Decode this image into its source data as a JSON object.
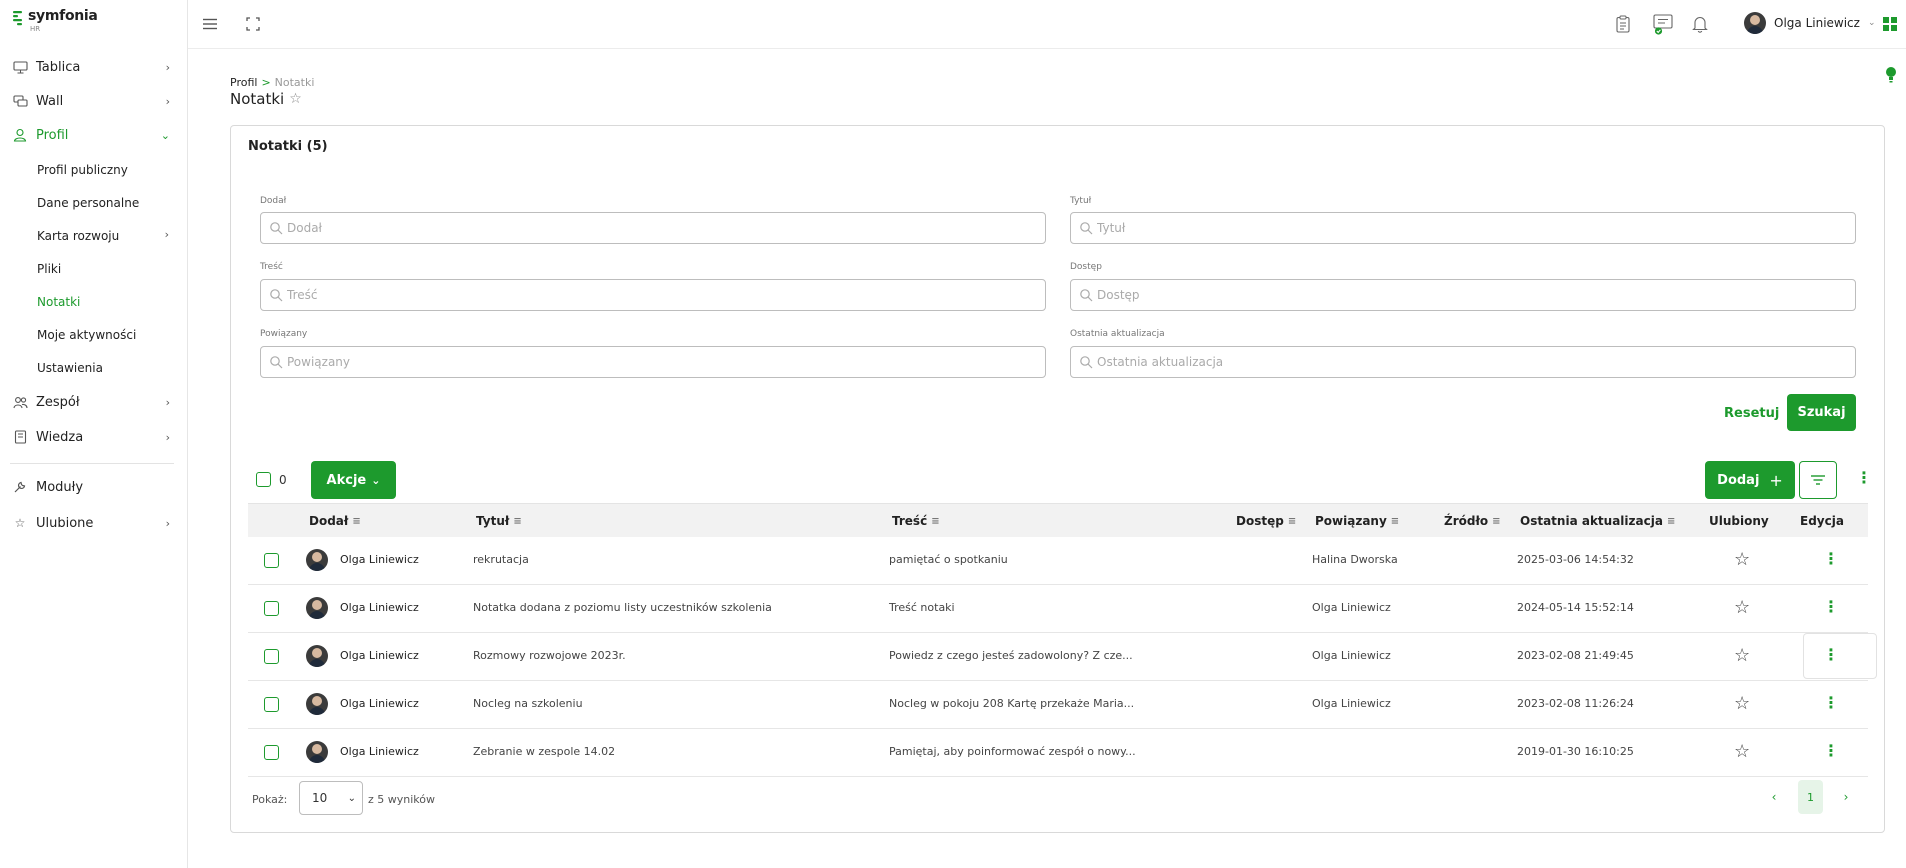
{
  "app": {
    "brand": "symfonia",
    "brand_sub": "HR",
    "accent": "#1d9a2d"
  },
  "sidebar": {
    "items": [
      {
        "label": "Tablica",
        "icon": "monitor-icon"
      },
      {
        "label": "Wall",
        "icon": "chat-icon"
      },
      {
        "label": "Profil",
        "icon": "user-icon"
      },
      {
        "label": "Zespół",
        "icon": "team-icon"
      },
      {
        "label": "Wiedza",
        "icon": "book-icon"
      },
      {
        "label": "Moduły",
        "icon": "wrench-icon"
      },
      {
        "label": "Ulubione",
        "icon": "star-icon"
      }
    ],
    "profile_sub": [
      "Profil publiczny",
      "Dane personalne",
      "Karta rozwoju",
      "Pliki",
      "Notatki",
      "Moje aktywności",
      "Ustawienia"
    ]
  },
  "topbar": {
    "user_name": "Olga Liniewicz"
  },
  "breadcrumb": {
    "parent": "Profil",
    "separator": ">",
    "current": "Notatki"
  },
  "page": {
    "title": "Notatki"
  },
  "card": {
    "title": "Notatki (5)"
  },
  "filters": [
    {
      "label": "Dodał",
      "placeholder": "Dodał"
    },
    {
      "label": "Tytuł",
      "placeholder": "Tytuł"
    },
    {
      "label": "Treść",
      "placeholder": "Treść"
    },
    {
      "label": "Dostęp",
      "placeholder": "Dostęp"
    },
    {
      "label": "Powiązany",
      "placeholder": "Powiązany"
    },
    {
      "label": "Ostatnia aktualizacja",
      "placeholder": "Ostatnia aktualizacja"
    }
  ],
  "actions": {
    "reset": "Resetuj",
    "search": "Szukaj",
    "selected_count": "0",
    "bulk": "Akcje",
    "add": "Dodaj"
  },
  "table": {
    "columns": [
      "Dodał",
      "Tytuł",
      "Treść",
      "Dostęp",
      "Powiązany",
      "Źródło",
      "Ostatnia aktualizacja",
      "Ulubiony",
      "Edycja"
    ],
    "rows": [
      {
        "author": "Olga Liniewicz",
        "title": "rekrutacja",
        "content": "pamiętać o spotkaniu",
        "access": "",
        "related": "Halina Dworska",
        "source": "",
        "updated": "2025-03-06 14:54:32"
      },
      {
        "author": "Olga Liniewicz",
        "title": "Notatka dodana z poziomu listy uczestników szkolenia",
        "content": "Treść notaki",
        "access": "",
        "related": "Olga Liniewicz",
        "source": "",
        "updated": "2024-05-14 15:52:14"
      },
      {
        "author": "Olga Liniewicz",
        "title": "Rozmowy rozwojowe 2023r.",
        "content": "Powiedz z czego jesteś zadowolony? Z cze...",
        "access": "",
        "related": "Olga Liniewicz",
        "source": "",
        "updated": "2023-02-08 21:49:45"
      },
      {
        "author": "Olga Liniewicz",
        "title": "Nocleg na szkoleniu",
        "content": "Nocleg w pokoju 208 Kartę przekaże Maria...",
        "access": "",
        "related": "Olga Liniewicz",
        "source": "",
        "updated": "2023-02-08 11:26:24"
      },
      {
        "author": "Olga Liniewicz",
        "title": "Zebranie w zespole 14.02",
        "content": "Pamiętaj, aby poinformować zespół o nowy...",
        "access": "",
        "related": "",
        "source": "",
        "updated": "2019-01-30 16:10:25"
      }
    ]
  },
  "footer": {
    "show_label": "Pokaż:",
    "page_size": "10",
    "results_label": "z 5 wyników",
    "current_page": "1"
  }
}
